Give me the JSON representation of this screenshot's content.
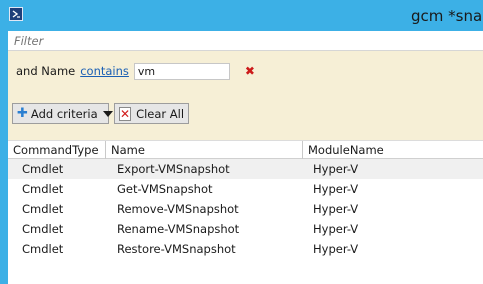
{
  "window": {
    "title": "gcm *snaps",
    "accent_color": "#3cb0e6"
  },
  "filter": {
    "placeholder": "Filter"
  },
  "criteria": {
    "label": "and Name",
    "operator": "contains",
    "value": "vm",
    "remove_icon": "remove-x-icon",
    "add_button_label": "Add criteria",
    "clear_button_label": "Clear All",
    "background_color": "#f6efd6"
  },
  "table": {
    "columns": [
      "CommandType",
      "Name",
      "ModuleName"
    ],
    "rows": [
      {
        "type": "Cmdlet",
        "name": "Export-VMSnapshot",
        "module": "Hyper-V"
      },
      {
        "type": "Cmdlet",
        "name": "Get-VMSnapshot",
        "module": "Hyper-V"
      },
      {
        "type": "Cmdlet",
        "name": "Remove-VMSnapshot",
        "module": "Hyper-V"
      },
      {
        "type": "Cmdlet",
        "name": "Rename-VMSnapshot",
        "module": "Hyper-V"
      },
      {
        "type": "Cmdlet",
        "name": "Restore-VMSnapshot",
        "module": "Hyper-V"
      }
    ]
  }
}
